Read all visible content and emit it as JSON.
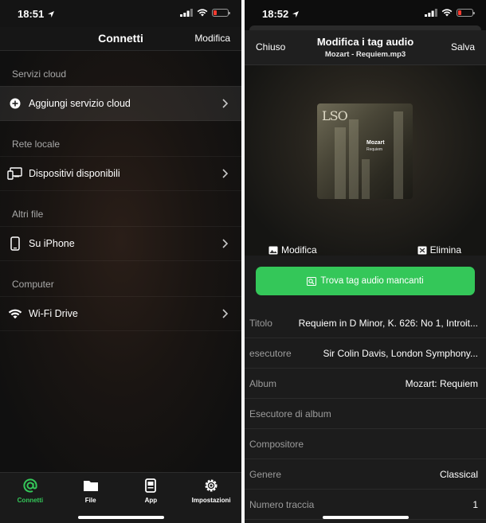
{
  "colors": {
    "accent_green": "#34c759",
    "battery_low": "#ff3b30",
    "background": "#141414"
  },
  "left": {
    "status": {
      "time": "18:51"
    },
    "nav": {
      "title": "Connetti",
      "edit_label": "Modifica"
    },
    "sections": [
      {
        "header": "Servizi cloud",
        "row": {
          "label": "Aggiungi servizio cloud",
          "icon": "plus-circle-icon"
        }
      },
      {
        "header": "Rete locale",
        "row": {
          "label": "Dispositivi disponibili",
          "icon": "devices-icon"
        }
      },
      {
        "header": "Altri file",
        "row": {
          "label": "Su iPhone",
          "icon": "iphone-icon"
        }
      },
      {
        "header": "Computer",
        "row": {
          "label": "Wi-Fi Drive",
          "icon": "wifi-icon"
        }
      }
    ],
    "tabs": [
      {
        "label": "Connetti",
        "icon": "at-sign-icon",
        "active": true
      },
      {
        "label": "File",
        "icon": "folder-icon"
      },
      {
        "label": "App",
        "icon": "app-icon"
      },
      {
        "label": "Impostazioni",
        "icon": "gear-icon"
      }
    ]
  },
  "right": {
    "status": {
      "time": "18:52"
    },
    "nav": {
      "cancel_label": "Chiuso",
      "title": "Modifica i tag audio",
      "subtitle": "Mozart - Requiem.mp3",
      "save_label": "Salva"
    },
    "cover": {
      "label": "LSO",
      "title": "Mozart",
      "subtitle": "Requiem"
    },
    "art_actions": {
      "edit_label": "Modifica",
      "delete_label": "Elimina"
    },
    "find_button_label": "Trova tag audio mancanti",
    "fields": [
      {
        "label": "Titolo",
        "value": "Requiem in D Minor, K. 626: No 1, Introit..."
      },
      {
        "label": "esecutore",
        "value": "Sir Colin Davis, London Symphony..."
      },
      {
        "label": "Album",
        "value": "Mozart: Requiem"
      },
      {
        "label": "Esecutore di album",
        "value": ""
      },
      {
        "label": "Compositore",
        "value": ""
      },
      {
        "label": "Genere",
        "value": "Classical"
      },
      {
        "label": "Numero traccia",
        "value": "1"
      }
    ]
  }
}
